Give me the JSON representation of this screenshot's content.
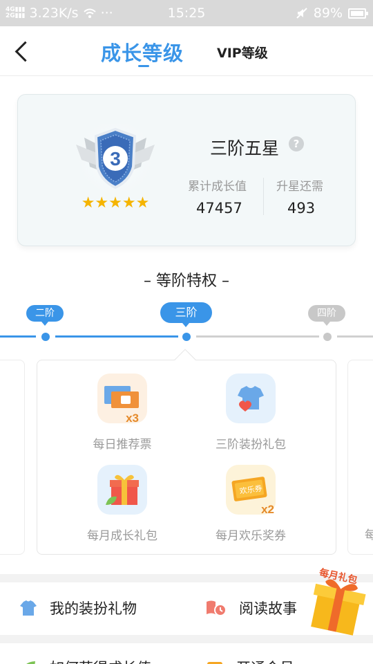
{
  "status_bar": {
    "network": "4G",
    "speed": "3.23K/s",
    "dots": "···",
    "time": "15:25",
    "battery": "89%"
  },
  "header": {
    "tabs": [
      {
        "label": "成长等级",
        "active": true
      },
      {
        "label": "VIP等级",
        "active": false
      }
    ]
  },
  "level_card": {
    "badge_number": "3",
    "stars": "★★★★★",
    "level_name": "三阶五星",
    "help": "?",
    "accumulated_label": "累计成长值",
    "accumulated_value": "47457",
    "upgrade_label": "升星还需",
    "upgrade_value": "493"
  },
  "privileges": {
    "title": "– 等阶特权 –",
    "tiers": [
      {
        "label": "二阶",
        "state": "done"
      },
      {
        "label": "三阶",
        "state": "current"
      },
      {
        "label": "四阶",
        "state": "locked"
      }
    ],
    "perks": [
      {
        "label": "每日推荐票",
        "badge": "x3",
        "icon": "ticket-icon"
      },
      {
        "label": "三阶装扮礼包",
        "icon": "tshirt-heart-icon"
      },
      {
        "label": "每月成长礼包",
        "icon": "gift-box-icon"
      },
      {
        "label": "每月欢乐奖券",
        "badge": "x2",
        "ticket_text": "欢乐券",
        "icon": "coupon-icon"
      }
    ],
    "right_card_partial": "每"
  },
  "bottom": {
    "row1": [
      {
        "label": "我的装扮礼物",
        "icon": "tshirt-icon"
      },
      {
        "label": "阅读故事",
        "icon": "book-clock-icon"
      }
    ],
    "row2": [
      {
        "label": "如何获得成长值",
        "icon": "leaf-icon"
      },
      {
        "label": "开通会员",
        "icon": "member-icon"
      }
    ],
    "monthly_gift": "每月礼包"
  },
  "colors": {
    "accent": "#3a95e8",
    "muted": "#999999",
    "gold": "#f5a623"
  }
}
